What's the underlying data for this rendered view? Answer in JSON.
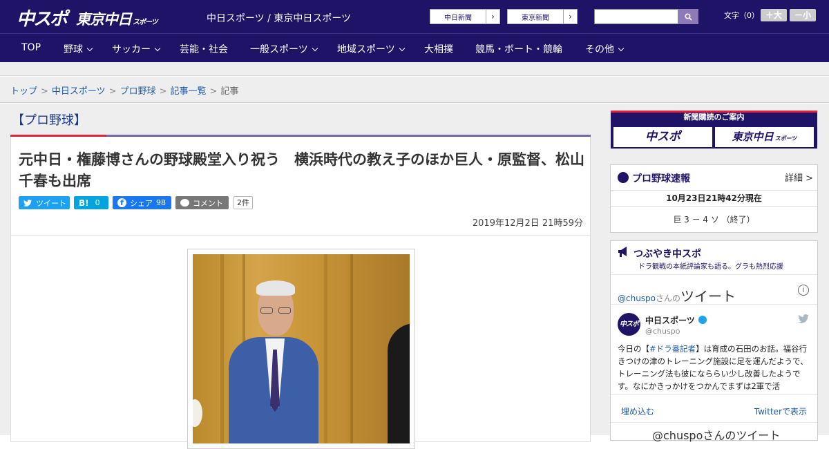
{
  "header": {
    "logo_main": "中スポ",
    "logo_sub": "東京中日",
    "logo_sub_small": "スポーツ",
    "site_name": "中日スポーツ / 東京中日スポーツ",
    "link1": "中日新聞",
    "link2": "東京新聞",
    "arrow": "›",
    "font_label": "文字（0）",
    "font_large": "＋大",
    "font_small": "－小"
  },
  "nav": {
    "items": [
      {
        "label": "TOP"
      },
      {
        "label": "野球"
      },
      {
        "label": "サッカー"
      },
      {
        "label": "芸能・社会"
      },
      {
        "label": "一般スポーツ"
      },
      {
        "label": "地域スポーツ"
      },
      {
        "label": "大相撲"
      },
      {
        "label": "競馬・ボート・競輪"
      },
      {
        "label": "その他"
      }
    ]
  },
  "breadcrumb": {
    "items": [
      "トップ",
      "中日スポーツ",
      "プロ野球",
      "記事一覧"
    ],
    "current": "記事",
    "sep": ">"
  },
  "article": {
    "category": "【プロ野球】",
    "title": "元中日・権藤博さんの野球殿堂入り祝う　横浜時代の教え子のほか巨人・原監督、松山千春も出席",
    "date": "2019年12月2日 21時59分",
    "share": {
      "tweet": "ツイート",
      "hatena_icon": "B!",
      "hatena_count": "0",
      "fb": "シェア",
      "fb_count": "98",
      "comment": "コメント",
      "comment_count": "2件"
    }
  },
  "sidebar": {
    "subscribe_title": "新聞購読のご案内",
    "sub_btn1": "中スポ",
    "sub_btn2": "東京中日",
    "sub_btn2_small": "スポーツ",
    "score": {
      "title": "プロ野球速報",
      "detail": "詳細 >",
      "time": "10月23日21時42分現在",
      "result": "巨 3 － 4 ソ （終了）"
    },
    "tsubuyaki": {
      "title": "つぶやき中スポ",
      "subtitle": "ドラ観戦の本紙評論家も語る。グラも熱烈応援",
      "handle_prefix": "@chuspo",
      "handle_suffix": "さんの",
      "tweet_word": "ツイート",
      "account_name": "中日スポーツ",
      "account_handle": "@chuspo",
      "avatar_text": "中スポ",
      "tweet_pre": "今日の【",
      "tweet_tag": "#ドラ番記者",
      "tweet_post": "】は育成の石田のお話。福谷行きつけの津のトレーニング施設に足を運んだようで、トレーニング法も彼になららい少し改善したようです。なにかきっかけをつかんでまずは2軍で活",
      "embed": "埋め込む",
      "view_twitter": "Twitterで表示",
      "footer": "@chuspoさんのツイート"
    }
  },
  "colors": {
    "brand": "#1e1366",
    "accent_red": "#e0253a",
    "link": "#1e5aa8",
    "twitter": "#1da1f2",
    "hatena": "#00a4de",
    "facebook": "#1877f2"
  }
}
